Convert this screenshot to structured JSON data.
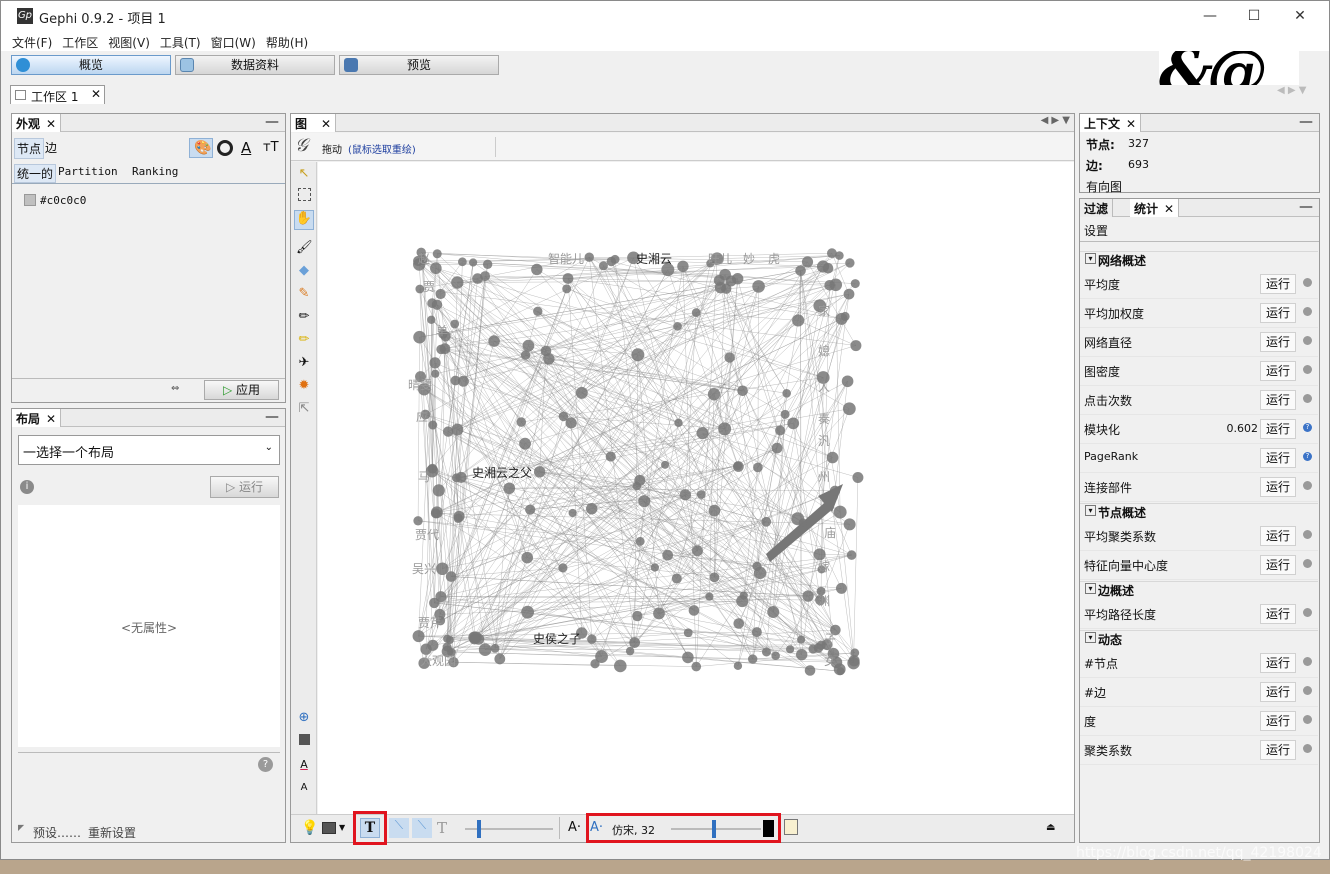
{
  "app": {
    "title": "Gephi 0.9.2 - 项目 1",
    "logo": "Gp"
  },
  "window_controls": {
    "minimize": "—",
    "maximize": "☐",
    "close": "✕"
  },
  "menu": [
    "文件(F)",
    "工作区",
    "视图(V)",
    "工具(T)",
    "窗口(W)",
    "帮助(H)"
  ],
  "modes": [
    {
      "label": "概览",
      "active": true,
      "color": "#2f8fd6"
    },
    {
      "label": "数据资料",
      "active": false,
      "color": "#7ab0d8"
    },
    {
      "label": "预览",
      "active": false,
      "color": "#4a78b0"
    }
  ],
  "workspace_tab": {
    "label": "工作区 1",
    "close": "✕"
  },
  "appearance": {
    "tab": "外观",
    "subtabs": [
      "节点",
      "边"
    ],
    "modes": [
      "统一的",
      "Partition",
      "Ranking"
    ],
    "color_value": "#c0c0c0",
    "apply": "应用"
  },
  "layout": {
    "tab": "布局",
    "select_placeholder": "一选择一个布局",
    "run": "运行",
    "no_property": "<无属性>",
    "presets": "预设……",
    "reset": "重新设置"
  },
  "graph": {
    "tab": "图",
    "mode_label": "拖动",
    "mode_hint": "(鼠标选取重绘)",
    "labels": [
      "史湘云",
      "史湘云之父",
      "史侯之子",
      "赵",
      "贾",
      "单",
      "晴雯",
      "应",
      "马",
      "贾代",
      "吴兴",
      "贾芹",
      "大观园",
      "智能儿",
      "旺儿",
      "妙",
      "虎",
      "家",
      "媳",
      "人",
      "奏",
      "汎",
      "州",
      "庙",
      "嫁",
      "渊",
      "子",
      "女"
    ],
    "font": "仿宋, 32"
  },
  "context": {
    "tab": "上下文",
    "nodes_label": "节点:",
    "nodes": "327",
    "edges_label": "边:",
    "edges": "693",
    "graph_type": "有向图"
  },
  "stats": {
    "tabs": [
      "过滤",
      "统计"
    ],
    "settings": "设置",
    "run_label": "运行",
    "sections": [
      {
        "title": "网络概述",
        "items": [
          {
            "name": "平均度",
            "value": ""
          },
          {
            "name": "平均加权度",
            "value": ""
          },
          {
            "name": "网络直径",
            "value": ""
          },
          {
            "name": "图密度",
            "value": ""
          },
          {
            "name": "点击次数",
            "value": ""
          },
          {
            "name": "模块化",
            "value": "0.602"
          },
          {
            "name": "PageRank",
            "value": ""
          },
          {
            "name": "连接部件",
            "value": ""
          }
        ]
      },
      {
        "title": "节点概述",
        "items": [
          {
            "name": "平均聚类系数",
            "value": ""
          },
          {
            "name": "特征向量中心度",
            "value": ""
          }
        ]
      },
      {
        "title": "边概述",
        "items": [
          {
            "name": "平均路径长度",
            "value": ""
          }
        ]
      },
      {
        "title": "动态",
        "items": [
          {
            "name": "#节点",
            "value": ""
          },
          {
            "name": "#边",
            "value": ""
          },
          {
            "name": "度",
            "value": ""
          },
          {
            "name": "聚类系数",
            "value": ""
          }
        ]
      }
    ]
  },
  "watermark": "https://blog.csdn.net/qq_42198024",
  "highlight_color": "#e0141e"
}
